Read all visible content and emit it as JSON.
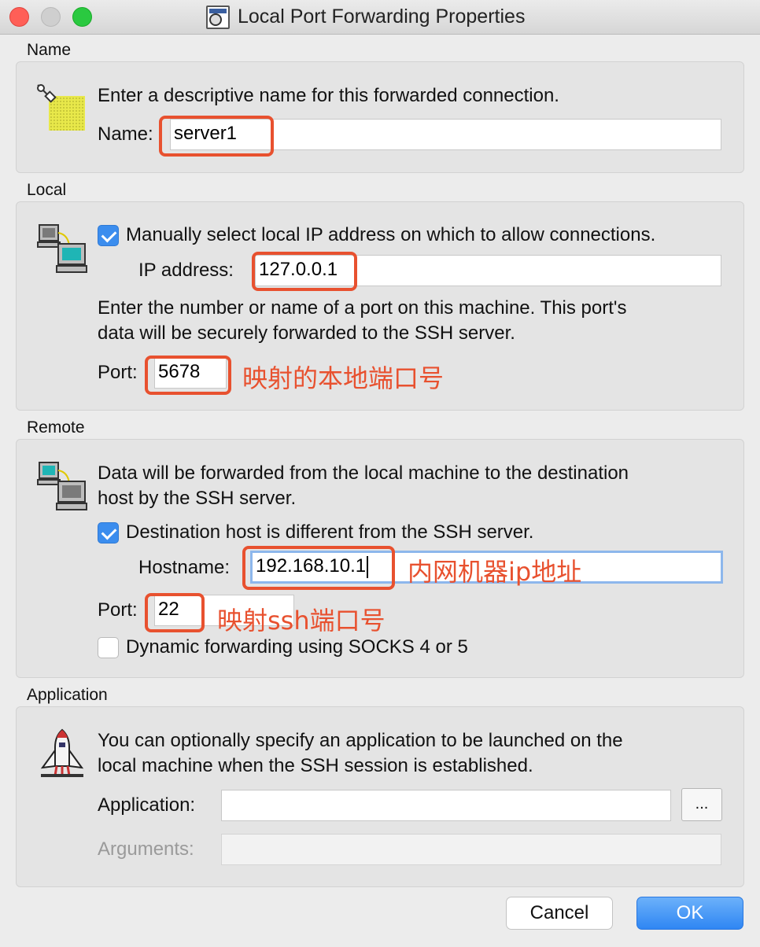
{
  "window": {
    "title": "Local Port Forwarding Properties"
  },
  "name_section": {
    "label": "Name",
    "description": "Enter a descriptive name for this forwarded connection.",
    "name_label": "Name:",
    "name_value": "server1"
  },
  "local_section": {
    "label": "Local",
    "manual_ip_checkbox_label": "Manually select local IP address on which to allow connections.",
    "manual_ip_checked": true,
    "ip_label": "IP address:",
    "ip_value": "127.0.0.1",
    "port_description_line1": "Enter the number or name of a port on this machine.  This port's",
    "port_description_line2": "data will be securely forwarded to the SSH server.",
    "port_label": "Port:",
    "port_value": "5678",
    "annotation": "映射的本地端口号"
  },
  "remote_section": {
    "label": "Remote",
    "description_line1": "Data will be forwarded from the local machine to the destination",
    "description_line2": "host by the SSH server.",
    "dest_checkbox_label": "Destination host is different from the SSH server.",
    "dest_checked": true,
    "hostname_label": "Hostname:",
    "hostname_value": "192.168.10.1",
    "hostname_annotation": "内网机器ip地址",
    "port_label": "Port:",
    "port_value": "22",
    "port_annotation": "映射ssh端口号",
    "socks_checkbox_label": "Dynamic forwarding using SOCKS 4 or 5",
    "socks_checked": false
  },
  "application_section": {
    "label": "Application",
    "description_line1": "You can optionally specify an application to be launched on the",
    "description_line2": "local machine when the SSH session is established.",
    "application_label": "Application:",
    "application_value": "",
    "browse_label": "...",
    "arguments_label": "Arguments:",
    "arguments_value": ""
  },
  "buttons": {
    "cancel": "Cancel",
    "ok": "OK"
  },
  "colors": {
    "annotation": "#e8512f",
    "accent": "#3b8dee"
  }
}
